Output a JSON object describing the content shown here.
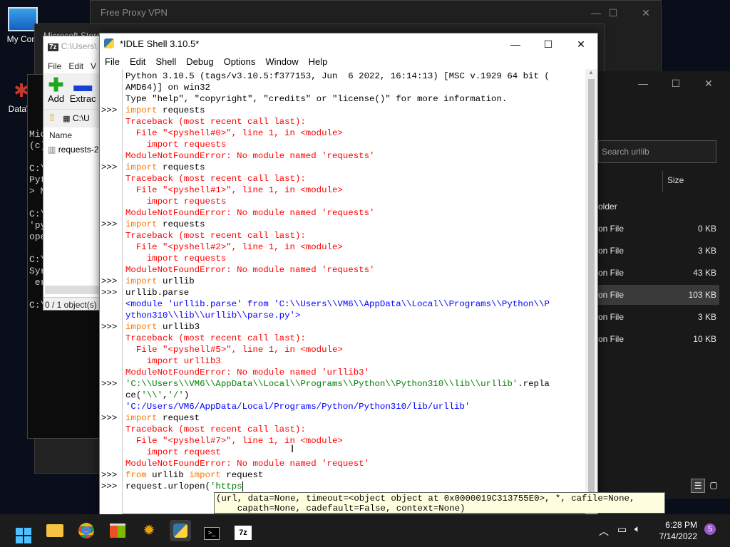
{
  "desktop": {
    "icons": [
      {
        "label": "My Com"
      },
      {
        "label": "DataW"
      }
    ]
  },
  "vpn_window": {
    "title": "Free Proxy VPN"
  },
  "store_window": {
    "title": "Microsoft Store"
  },
  "cmd_window": {
    "lines": [
      "Mic",
      "(c)",
      "",
      "C:\\",
      "Pyt",
      "> M",
      "",
      "C:\\",
      "'py",
      "ope",
      "",
      "C:\\",
      "Syr",
      " er",
      "",
      "C:\\"
    ]
  },
  "sevenzip_window": {
    "path": "C:\\Users\\",
    "menu": [
      "File",
      "Edit",
      "V"
    ],
    "tools": {
      "add": "Add",
      "extract": "Extrac"
    },
    "address": "C:\\U",
    "col_name": "Name",
    "file": "requests-2",
    "status": "0 / 1 object(s)"
  },
  "explorer_window": {
    "search_placeholder": "Search urllib",
    "col_size": "Size",
    "rows": [
      {
        "type": "older",
        "size": ""
      },
      {
        "type": "on File",
        "size": "0 KB"
      },
      {
        "type": "on File",
        "size": "3 KB"
      },
      {
        "type": "on File",
        "size": "43 KB"
      },
      {
        "type": "on File",
        "size": "103 KB"
      },
      {
        "type": "on File",
        "size": "3 KB"
      },
      {
        "type": "on File",
        "size": "10 KB"
      }
    ]
  },
  "idle": {
    "title": "*IDLE Shell 3.10.5*",
    "menu": [
      "File",
      "Edit",
      "Shell",
      "Debug",
      "Options",
      "Window",
      "Help"
    ],
    "prompt": ">>>",
    "lines": [
      {
        "p": false,
        "t": "out",
        "s": "Python 3.10.5 (tags/v3.10.5:f377153, Jun  6 2022, 16:14:13) [MSC v.1929 64 bit ("
      },
      {
        "p": false,
        "t": "out",
        "s": "AMD64)] on win32"
      },
      {
        "p": false,
        "t": "out",
        "s": "Type \"help\", \"copyright\", \"credits\" or \"license()\" for more information."
      },
      {
        "p": true,
        "t": "code",
        "kw": "import",
        "s": " requests"
      },
      {
        "p": false,
        "t": "err",
        "s": "Traceback (most recent call last):"
      },
      {
        "p": false,
        "t": "err",
        "s": "  File \"<pyshell#0>\", line 1, in <module>"
      },
      {
        "p": false,
        "t": "err",
        "s": "    import requests"
      },
      {
        "p": false,
        "t": "err",
        "s": "ModuleNotFoundError: No module named 'requests'"
      },
      {
        "p": true,
        "t": "code",
        "kw": "import",
        "s": " requests"
      },
      {
        "p": false,
        "t": "err",
        "s": "Traceback (most recent call last):"
      },
      {
        "p": false,
        "t": "err",
        "s": "  File \"<pyshell#1>\", line 1, in <module>"
      },
      {
        "p": false,
        "t": "err",
        "s": "    import requests"
      },
      {
        "p": false,
        "t": "err",
        "s": "ModuleNotFoundError: No module named 'requests'"
      },
      {
        "p": true,
        "t": "code",
        "kw": "import",
        "s": " requests"
      },
      {
        "p": false,
        "t": "err",
        "s": "Traceback (most recent call last):"
      },
      {
        "p": false,
        "t": "err",
        "s": "  File \"<pyshell#2>\", line 1, in <module>"
      },
      {
        "p": false,
        "t": "err",
        "s": "    import requests"
      },
      {
        "p": false,
        "t": "err",
        "s": "ModuleNotFoundError: No module named 'requests'"
      },
      {
        "p": true,
        "t": "code",
        "kw": "import",
        "s": " urllib"
      },
      {
        "p": true,
        "t": "out",
        "s": "urllib.parse"
      },
      {
        "p": false,
        "t": "res",
        "s": "<module 'urllib.parse' from 'C:\\\\Users\\\\VM6\\\\AppData\\\\Local\\\\Programs\\\\Python\\\\P"
      },
      {
        "p": false,
        "t": "res",
        "s": "ython310\\\\lib\\\\urllib\\\\parse.py'>"
      },
      {
        "p": true,
        "t": "code",
        "kw": "import",
        "s": " urllib3"
      },
      {
        "p": false,
        "t": "err",
        "s": "Traceback (most recent call last):"
      },
      {
        "p": false,
        "t": "err",
        "s": "  File \"<pyshell#5>\", line 1, in <module>"
      },
      {
        "p": false,
        "t": "err",
        "s": "    import urllib3"
      },
      {
        "p": false,
        "t": "err",
        "s": "ModuleNotFoundError: No module named 'urllib3'"
      },
      {
        "p": true,
        "t": "strline",
        "str": "'C:\\\\Users\\\\VM6\\\\AppData\\\\Local\\\\Programs\\\\Python\\\\Python310\\\\lib\\\\urllib'",
        "s": ".repla"
      },
      {
        "p": false,
        "t": "strline2",
        "a": "ce(",
        "str": "'\\\\'",
        "b": ",",
        "str2": "'/'",
        "c": ")"
      },
      {
        "p": false,
        "t": "res",
        "s": "'C:/Users/VM6/AppData/Local/Programs/Python/Python310/lib/urllib'"
      },
      {
        "p": true,
        "t": "code",
        "kw": "import",
        "s": " request"
      },
      {
        "p": false,
        "t": "err",
        "s": "Traceback (most recent call last):"
      },
      {
        "p": false,
        "t": "err",
        "s": "  File \"<pyshell#7>\", line 1, in <module>"
      },
      {
        "p": false,
        "t": "err",
        "s": "    import request"
      },
      {
        "p": false,
        "t": "err",
        "s": "ModuleNotFoundError: No module named 'request'"
      },
      {
        "p": true,
        "t": "from",
        "k1": "from",
        "m": " urllib ",
        "k2": "import",
        "s": " request"
      },
      {
        "p": true,
        "t": "call",
        "a": "request.urlopen(",
        "str": "'https"
      }
    ],
    "calltip": "(url, data=None, timeout=<object object at 0x0000019C313755E0>, *, cafile=None,\n    capath=None, cadefault=False, context=None)"
  },
  "taskbar": {
    "time": "6:28 PM",
    "date": "7/14/2022",
    "badge": "5"
  },
  "colors": {
    "keyword": "#ff7700",
    "error": "#ff0000",
    "string": "#008000",
    "result": "#0000ff"
  }
}
